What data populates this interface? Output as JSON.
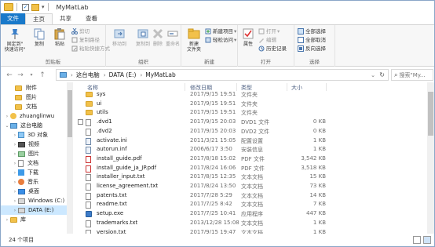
{
  "window": {
    "title": "MyMatLab"
  },
  "tabs": [
    "文件",
    "主页",
    "共享",
    "查看"
  ],
  "ribbon": {
    "clipboard": {
      "label": "剪贴板",
      "pin": "固定到\"\n快速访问\"",
      "copy": "复制",
      "paste": "粘贴",
      "cut": "剪切",
      "copy_path": "复制路径",
      "paste_shortcut": "粘贴快捷方式"
    },
    "organize": {
      "label": "组织",
      "move_to": "移动到",
      "copy_to": "复制到",
      "delete": "删除",
      "rename": "重命名"
    },
    "new": {
      "label": "新建",
      "new_folder": "新建\n文件夹",
      "new_item": "新建项目",
      "easy_access": "轻松访问"
    },
    "open": {
      "label": "打开",
      "properties": "属性",
      "open": "打开",
      "edit": "编辑",
      "history": "历史记录"
    },
    "select": {
      "label": "选择",
      "select_all": "全部选择",
      "select_none": "全部取消",
      "invert": "反向选择"
    }
  },
  "address": {
    "crumbs": [
      "这台电脑",
      "DATA (E:)",
      "MyMatLab"
    ],
    "search_placeholder": "搜索\"My..."
  },
  "nav": {
    "items": [
      {
        "label": "附件",
        "icon": "folder-icon"
      },
      {
        "label": "图片",
        "icon": "folder-icon"
      },
      {
        "label": "文档",
        "icon": "folder-icon"
      },
      {
        "label": "zhuanglinwu",
        "icon": "user-icon"
      },
      {
        "label": "这台电脑",
        "icon": "computer-icon"
      },
      {
        "label": "3D 对象",
        "icon": "3d-objects-icon"
      },
      {
        "label": "视频",
        "icon": "video-icon"
      },
      {
        "label": "图片",
        "icon": "pictures-icon"
      },
      {
        "label": "文档",
        "icon": "documents-icon"
      },
      {
        "label": "下载",
        "icon": "download-icon"
      },
      {
        "label": "音乐",
        "icon": "music-icon"
      },
      {
        "label": "桌面",
        "icon": "desktop-icon"
      },
      {
        "label": "Windows (C:)",
        "icon": "drive-icon"
      },
      {
        "label": "DATA (E:)",
        "icon": "drive-icon"
      },
      {
        "label": "库",
        "icon": "library-icon"
      }
    ]
  },
  "columns": {
    "name": "名称",
    "date": "修改日期",
    "type": "类型",
    "size": "大小"
  },
  "files": [
    {
      "name": "sys",
      "date": "2017/9/15 19:51",
      "type": "文件夹",
      "size": "",
      "icon": "folder"
    },
    {
      "name": "ui",
      "date": "2017/9/15 19:51",
      "type": "文件夹",
      "size": "",
      "icon": "folder"
    },
    {
      "name": "utils",
      "date": "2017/9/15 19:51",
      "type": "文件夹",
      "size": "",
      "icon": "folder"
    },
    {
      "name": ".dvd1",
      "date": "2017/9/15 20:03",
      "type": "DVD1 文件",
      "size": "0 KB",
      "icon": "doc"
    },
    {
      "name": ".dvd2",
      "date": "2017/9/15 20:03",
      "type": "DVD2 文件",
      "size": "0 KB",
      "icon": "doc"
    },
    {
      "name": "activate.ini",
      "date": "2011/3/21 15:05",
      "type": "配置设置",
      "size": "1 KB",
      "icon": "ini"
    },
    {
      "name": "autorun.inf",
      "date": "2006/6/17 3:50",
      "type": "安装信息",
      "size": "1 KB",
      "icon": "ini"
    },
    {
      "name": "install_guide.pdf",
      "date": "2017/8/18 15:02",
      "type": "PDF 文件",
      "size": "3,542 KB",
      "icon": "pdf"
    },
    {
      "name": "install_guide_ja_JP.pdf",
      "date": "2017/8/24 16:06",
      "type": "PDF 文件",
      "size": "3,518 KB",
      "icon": "pdf"
    },
    {
      "name": "installer_input.txt",
      "date": "2017/8/15 12:35",
      "type": "文本文档",
      "size": "15 KB",
      "icon": "doc"
    },
    {
      "name": "license_agreement.txt",
      "date": "2017/8/24 13:50",
      "type": "文本文档",
      "size": "73 KB",
      "icon": "doc"
    },
    {
      "name": "patents.txt",
      "date": "2017/7/28 5:29",
      "type": "文本文档",
      "size": "14 KB",
      "icon": "doc"
    },
    {
      "name": "readme.txt",
      "date": "2017/7/25 8:42",
      "type": "文本文档",
      "size": "7 KB",
      "icon": "doc"
    },
    {
      "name": "setup.exe",
      "date": "2017/7/25 10:41",
      "type": "应用程序",
      "size": "447 KB",
      "icon": "exe"
    },
    {
      "name": "trademarks.txt",
      "date": "2013/12/28 15:08",
      "type": "文本文档",
      "size": "1 KB",
      "icon": "doc"
    },
    {
      "name": "version.txt",
      "date": "2017/9/15 19:47",
      "type": "文本文档",
      "size": "1 KB",
      "icon": "doc"
    }
  ],
  "status": {
    "count": "24 个项目"
  }
}
